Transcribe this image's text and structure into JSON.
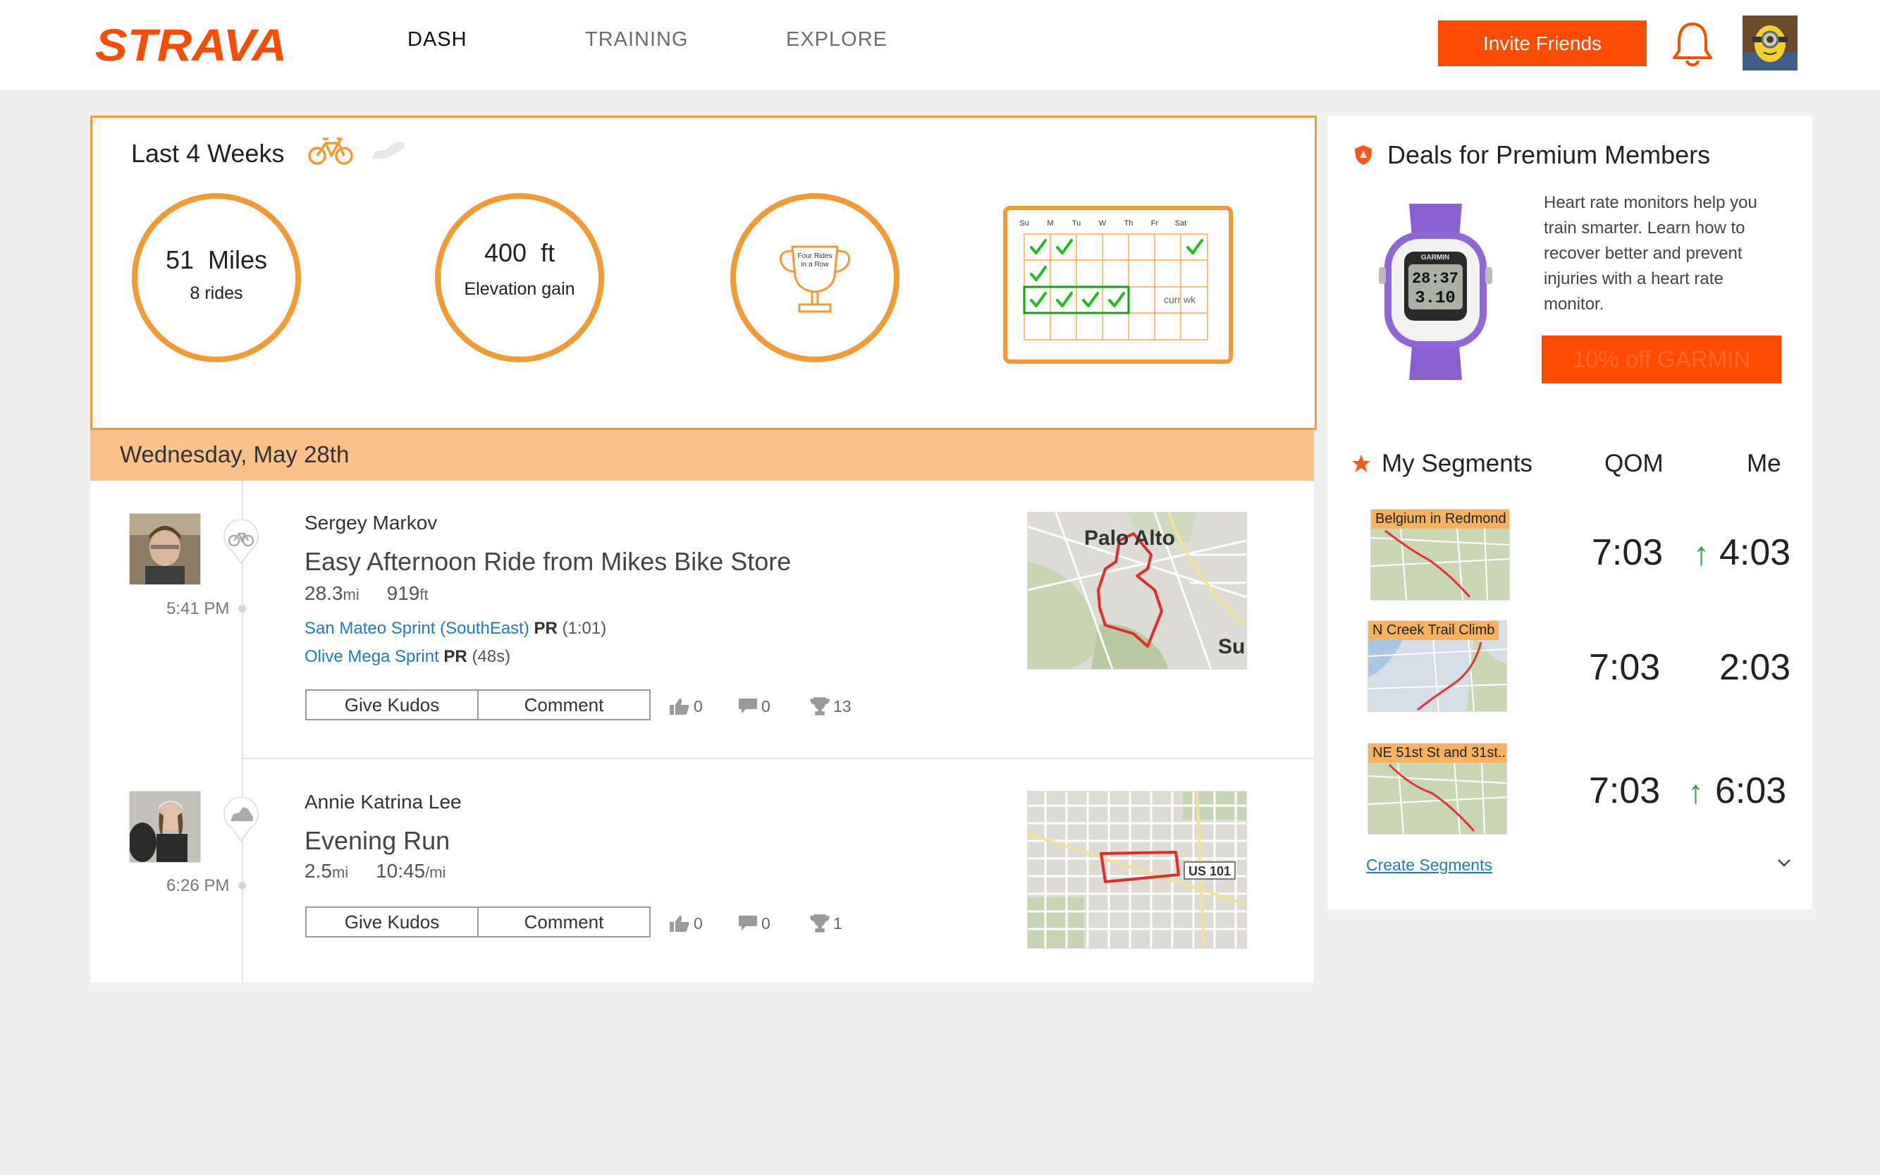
{
  "brand": {
    "name": "STRAVA",
    "color": "#fc4c02"
  },
  "nav": {
    "items": [
      {
        "label": "DASH",
        "active": true
      },
      {
        "label": "TRAINING",
        "active": false
      },
      {
        "label": "EXPLORE",
        "active": false
      }
    ],
    "invite_label": "Invite Friends",
    "bell_icon": "bell-icon",
    "avatar_icon": "user-avatar"
  },
  "summary": {
    "title": "Last 4 Weeks",
    "sport_tabs": [
      "bike-icon",
      "running-shoe-icon"
    ],
    "distance": {
      "value": "51",
      "unit": "Miles",
      "sub": "8 rides"
    },
    "elevation": {
      "value": "400",
      "unit": "ft",
      "sub": "Elevation gain"
    },
    "trophy": {
      "label_line1": "Four Rides",
      "label_line2": "in a Row"
    },
    "calendar": {
      "days": [
        "Su",
        "M",
        "Tu",
        "W",
        "Th",
        "Fr",
        "Sat"
      ],
      "current_week_label": "curr wk"
    }
  },
  "feed": {
    "date": "Wednesday, May 28th",
    "activities": [
      {
        "athlete": "Sergey Markov",
        "sport_icon": "bike-icon",
        "time": "5:41 PM",
        "title": "Easy Afternoon Ride from Mikes Bike Store",
        "stat1_value": "28.3",
        "stat1_unit": "mi",
        "stat2_value": "919",
        "stat2_unit": "ft",
        "segments": [
          {
            "name": "San Mateo Sprint (SouthEast)",
            "pr": "PR",
            "time": "(1:01)"
          },
          {
            "name": "Olive Mega Sprint",
            "pr": "PR",
            "time": "(48s)"
          }
        ],
        "kudos_label": "Give Kudos",
        "comment_label": "Comment",
        "kudos_count": "0",
        "comment_count": "0",
        "achievements_count": "13",
        "map_label1": "Palo Alto",
        "map_label2": "Su"
      },
      {
        "athlete": "Annie Katrina Lee",
        "sport_icon": "running-shoe-icon",
        "time": "6:26 PM",
        "title": "Evening Run",
        "stat1_value": "2.5",
        "stat1_unit": "mi",
        "stat2_value": "10:45",
        "stat2_unit": "/mi",
        "kudos_label": "Give Kudos",
        "comment_label": "Comment",
        "kudos_count": "0",
        "comment_count": "0",
        "achievements_count": "1",
        "map_label1": "US 101"
      }
    ]
  },
  "deals": {
    "title": "Deals for Premium Members",
    "watch_brand": "GARMIN",
    "watch_time": "28:37",
    "watch_distance": "3.10",
    "text": "Heart rate monitors help you train smarter. Learn how to recover better and prevent injuries with a heart rate monitor.",
    "button_label": "10% off GARMIN"
  },
  "segments": {
    "title": "My Segments",
    "col_qom": "QOM",
    "col_me": "Me",
    "items": [
      {
        "name": "Belgium in Redmond",
        "qom": "7:03",
        "me": "4:03",
        "improved": true
      },
      {
        "name": "N Creek Trail Climb",
        "qom": "7:03",
        "me": "2:03",
        "improved": false
      },
      {
        "name": "NE 51st St and 31st...",
        "qom": "7:03",
        "me": "6:03",
        "improved": true
      }
    ],
    "up_arrow": "↑",
    "create_label": "Create Segments"
  }
}
